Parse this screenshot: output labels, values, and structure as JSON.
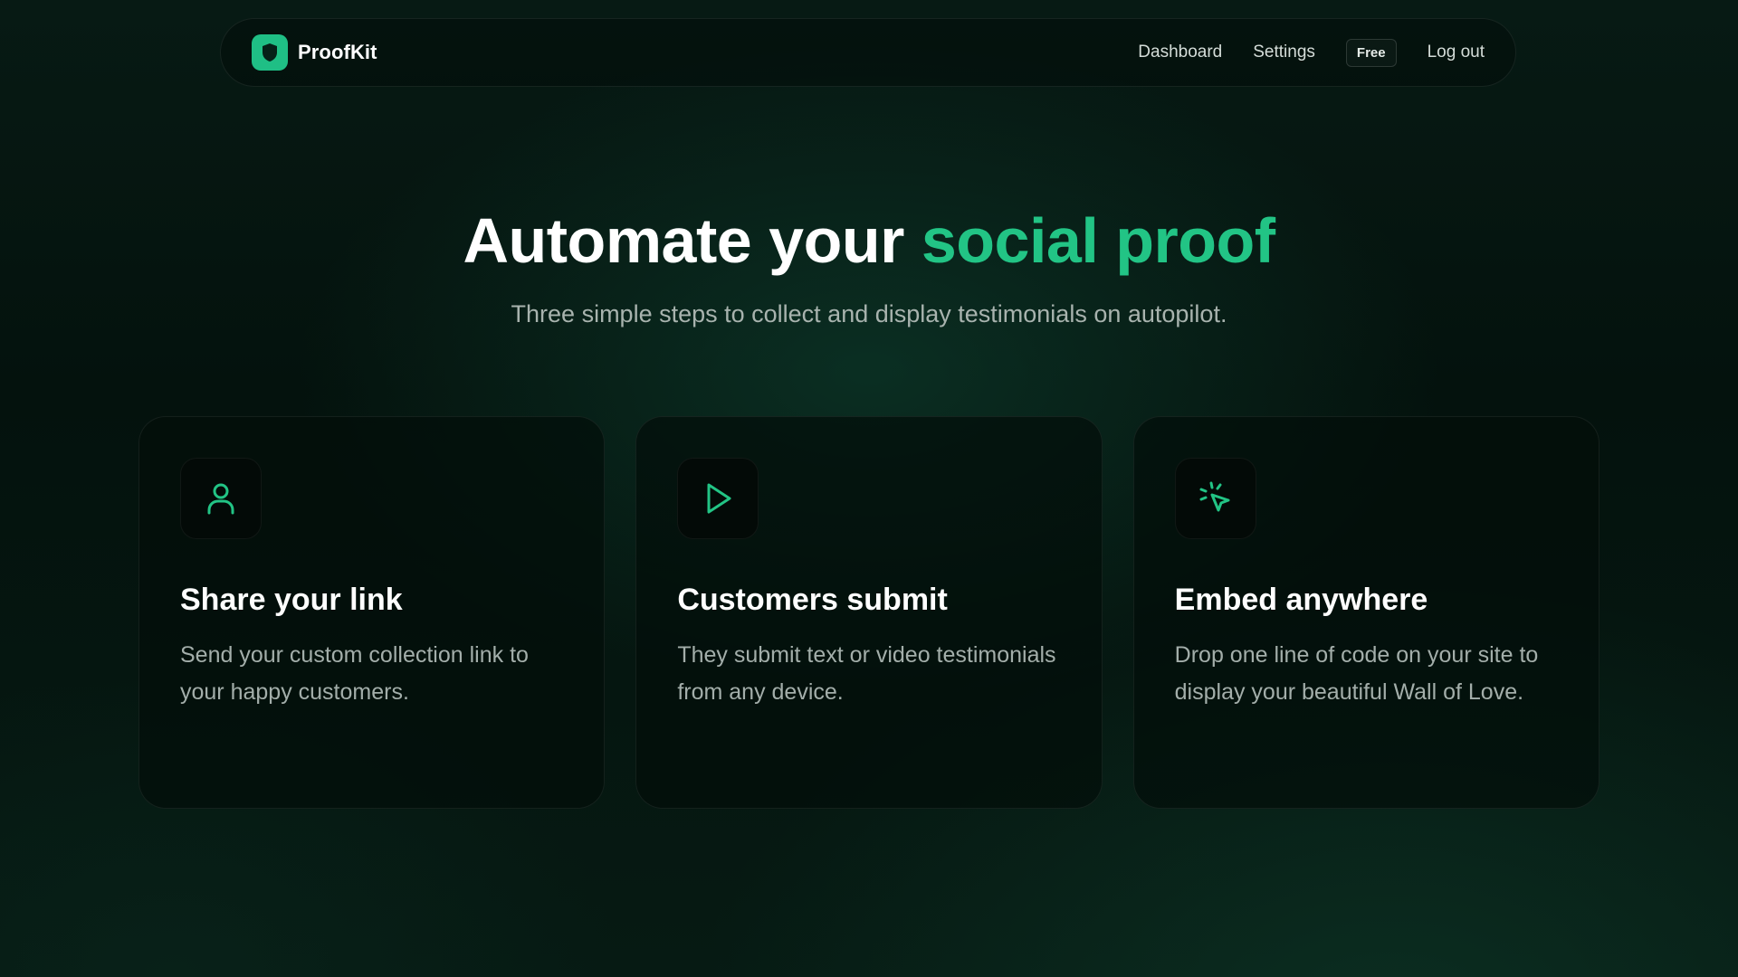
{
  "nav": {
    "brand": "ProofKit",
    "links": {
      "dashboard": "Dashboard",
      "settings": "Settings",
      "plan_badge": "Free",
      "logout": "Log out"
    },
    "logo_icon": "shield-icon"
  },
  "hero": {
    "title_main": "Automate your ",
    "title_accent": "social proof",
    "subtitle": "Three simple steps to collect and display testimonials on autopilot."
  },
  "steps": [
    {
      "icon": "user-icon",
      "title": "Share your link",
      "description": "Send your custom collection link to your happy customers."
    },
    {
      "icon": "play-icon",
      "title": "Customers submit",
      "description": "They submit text or video testimonials from any device."
    },
    {
      "icon": "cursor-click-icon",
      "title": "Embed anywhere",
      "description": "Drop one line of code on your site to display your beautiful Wall of Love."
    }
  ],
  "colors": {
    "accent": "#22c485",
    "logo_bg": "#1fbf85",
    "background": "#061a13",
    "card_bg": "#030e0a",
    "muted_text": "#a3aeaa"
  }
}
